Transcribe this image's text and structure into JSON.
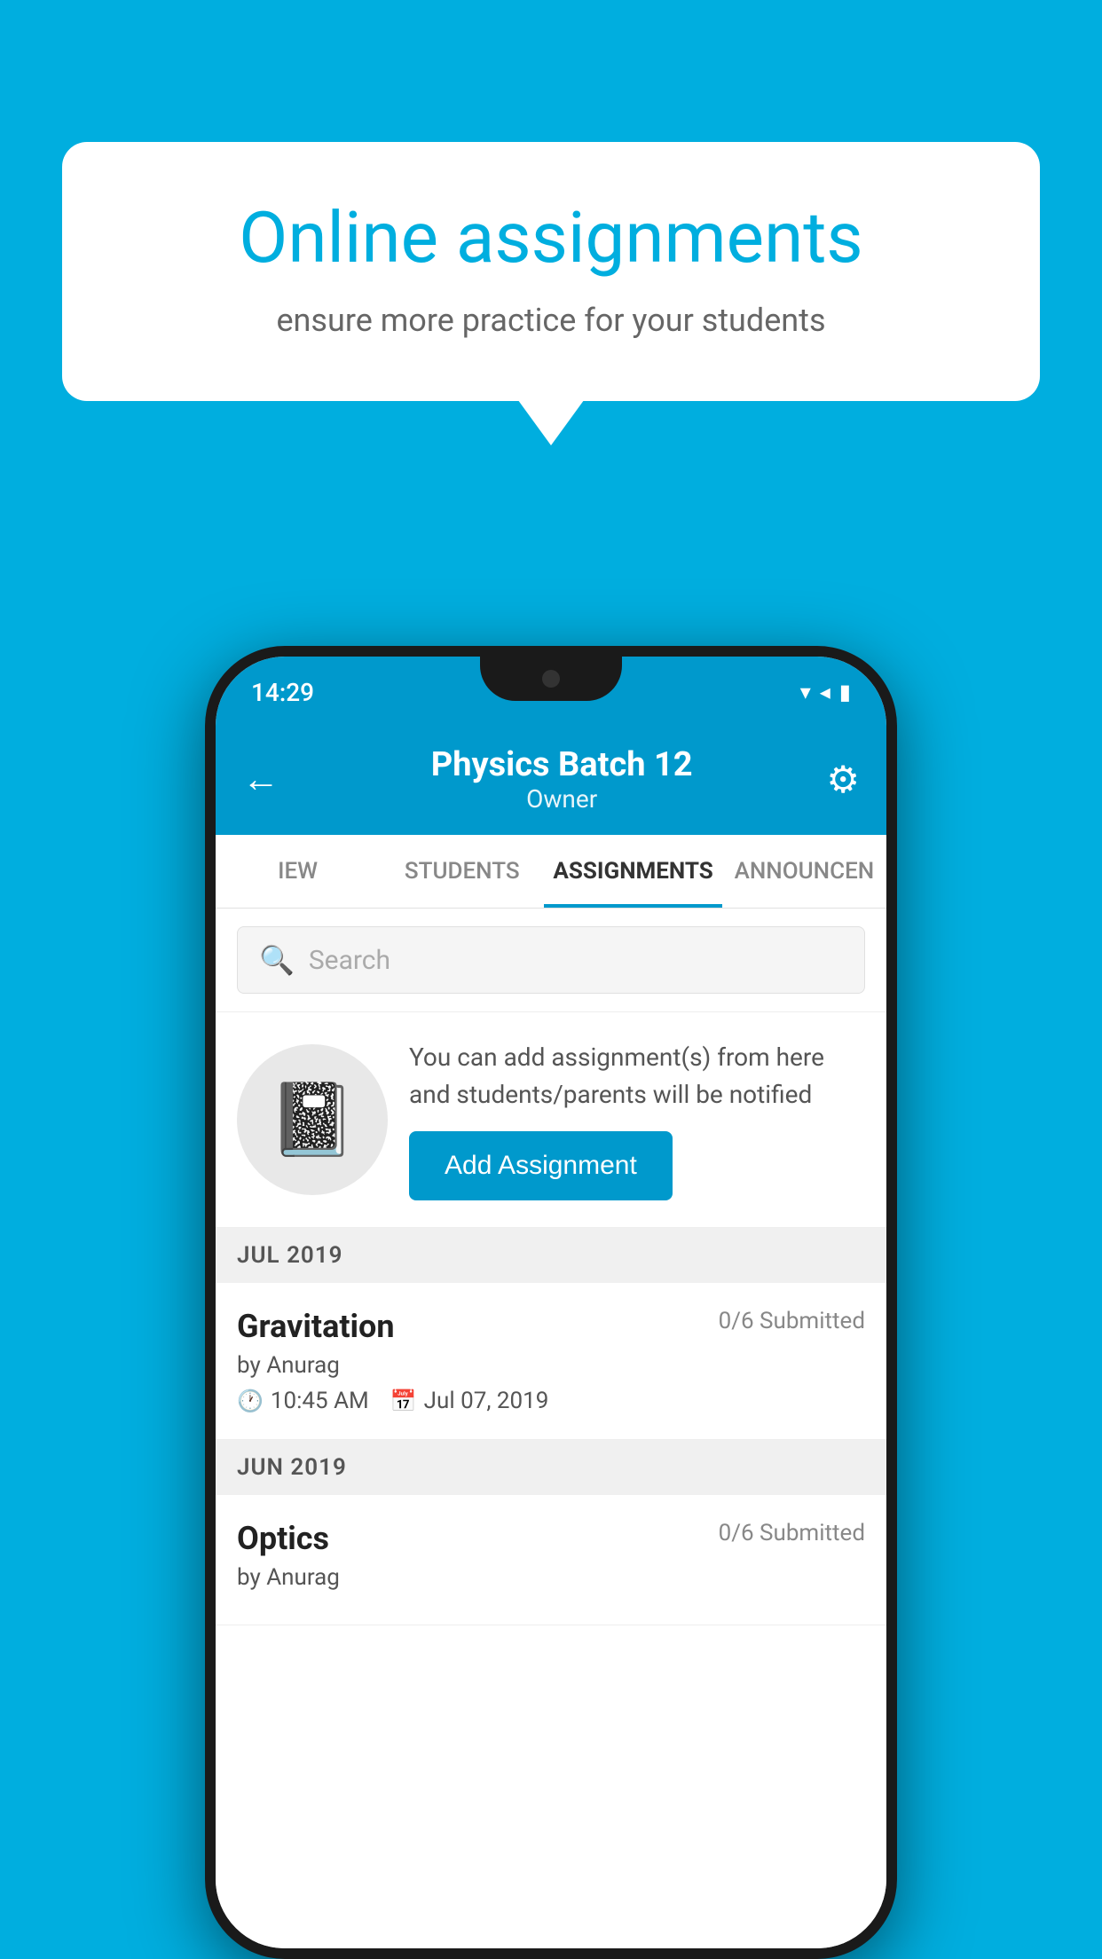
{
  "background_color": "#00AEDF",
  "speech_bubble": {
    "title": "Online assignments",
    "subtitle": "ensure more practice for your students"
  },
  "phone": {
    "status_bar": {
      "time": "14:29",
      "icons": [
        "wifi",
        "signal",
        "battery"
      ]
    },
    "header": {
      "title": "Physics Batch 12",
      "subtitle": "Owner",
      "back_label": "←",
      "settings_label": "⚙"
    },
    "tabs": [
      {
        "label": "IEW",
        "active": false
      },
      {
        "label": "STUDENTS",
        "active": false
      },
      {
        "label": "ASSIGNMENTS",
        "active": true
      },
      {
        "label": "ANNOUNCEN",
        "active": false
      }
    ],
    "search": {
      "placeholder": "Search"
    },
    "promo": {
      "text": "You can add assignment(s) from here and students/parents will be notified",
      "button_label": "Add Assignment"
    },
    "sections": [
      {
        "header": "JUL 2019",
        "assignments": [
          {
            "name": "Gravitation",
            "submitted": "0/6 Submitted",
            "by": "by Anurag",
            "time": "10:45 AM",
            "date": "Jul 07, 2019"
          }
        ]
      },
      {
        "header": "JUN 2019",
        "assignments": [
          {
            "name": "Optics",
            "submitted": "0/6 Submitted",
            "by": "by Anurag",
            "time": "",
            "date": ""
          }
        ]
      }
    ]
  }
}
